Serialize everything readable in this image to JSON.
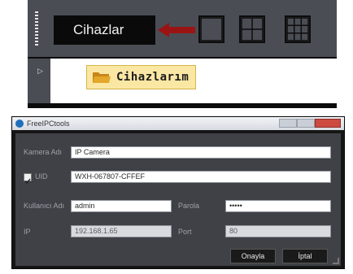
{
  "top": {
    "title": "Cihazlar",
    "tree_node": "Cihazlarım"
  },
  "dialog": {
    "title": "FreeIPCtools",
    "fields": {
      "camera_name_label": "Kamera Adı",
      "camera_name_value": "IP Camera",
      "uid_label": "UID",
      "uid_value": "WXH-067807-CFFEF",
      "username_label": "Kullanıcı Adı",
      "username_value": "admin",
      "password_label": "Parola",
      "password_value": "•••••",
      "ip_label": "IP",
      "ip_value": "192.168.1.65",
      "port_label": "Port",
      "port_value": "80"
    },
    "buttons": {
      "confirm": "Onayla",
      "cancel": "İptal"
    }
  },
  "colors": {
    "arrow": "#9b1414",
    "folder": "#e3a72a",
    "node_highlight": "#fbe7a4"
  }
}
